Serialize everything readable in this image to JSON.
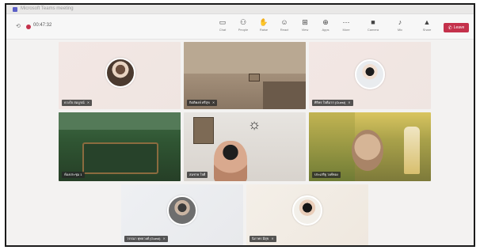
{
  "window": {
    "title": "Microsoft Teams meeting",
    "brand_color": "#5b5fc7"
  },
  "toolbar": {
    "meeting_time": "00:47:32",
    "buttons": [
      {
        "label": "Chat",
        "icon": "chat-icon"
      },
      {
        "label": "People",
        "icon": "people-icon"
      },
      {
        "label": "Raise",
        "icon": "raise-hand-icon"
      },
      {
        "label": "React",
        "icon": "react-icon"
      },
      {
        "label": "View",
        "icon": "view-icon"
      },
      {
        "label": "Apps",
        "icon": "apps-icon"
      },
      {
        "label": "More",
        "icon": "more-icon"
      },
      {
        "label": "Camera",
        "icon": "camera-icon"
      },
      {
        "label": "Mic",
        "icon": "mic-icon"
      },
      {
        "label": "Share",
        "icon": "share-icon"
      }
    ],
    "leave_label": "Leave",
    "leave_color": "#c4314b"
  },
  "participants": [
    {
      "name": "ดวงใจ สมบูรณ์",
      "muted": true,
      "type": "avatar"
    },
    {
      "name": "กิตติพงษ์ ศรีสุข",
      "muted": true,
      "type": "video"
    },
    {
      "name": "ศิริพร ใจดีมาก (Guest)",
      "muted": true,
      "type": "avatar"
    },
    {
      "name": "ห้องประชุม 1",
      "muted": false,
      "type": "video"
    },
    {
      "name": "สมชาย ใจดี",
      "muted": false,
      "type": "video"
    },
    {
      "name": "ประเสริฐ วงศ์ทอง",
      "muted": false,
      "type": "video"
    },
    {
      "name": "วรรณา พุทธวงศ์ (Guest)",
      "muted": true,
      "type": "avatar"
    },
    {
      "name": "นิภาพร มีสุข",
      "muted": true,
      "type": "avatar"
    }
  ]
}
